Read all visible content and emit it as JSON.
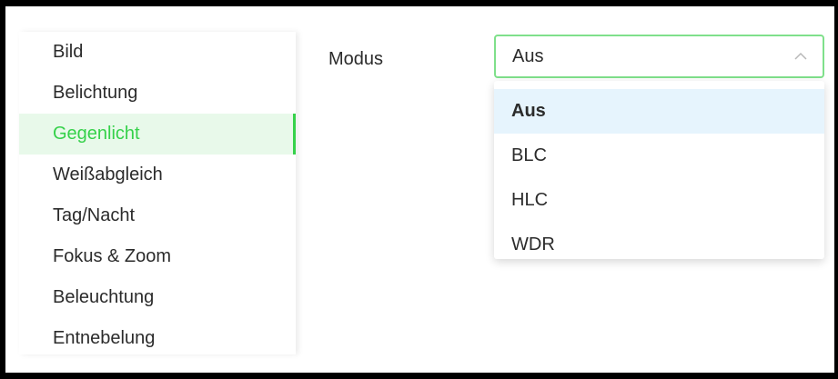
{
  "sidebar": {
    "items": [
      {
        "label": "Bild"
      },
      {
        "label": "Belichtung"
      },
      {
        "label": "Gegenlicht",
        "active": true
      },
      {
        "label": "Weißabgleich"
      },
      {
        "label": "Tag/Nacht"
      },
      {
        "label": "Fokus & Zoom"
      },
      {
        "label": "Beleuchtung"
      },
      {
        "label": "Entnebelung"
      }
    ]
  },
  "form": {
    "mode_label": "Modus",
    "mode_value": "Aus",
    "mode_options": [
      "Aus",
      "BLC",
      "HLC",
      "WDR"
    ],
    "selected_option": "Aus"
  },
  "colors": {
    "accent": "#35d14a",
    "active_bg": "#e8f9ea",
    "selected_option_bg": "#e6f4fd",
    "focus_border": "#7fe08b"
  },
  "icons": {
    "select_chevron": "chevron-up-icon"
  }
}
